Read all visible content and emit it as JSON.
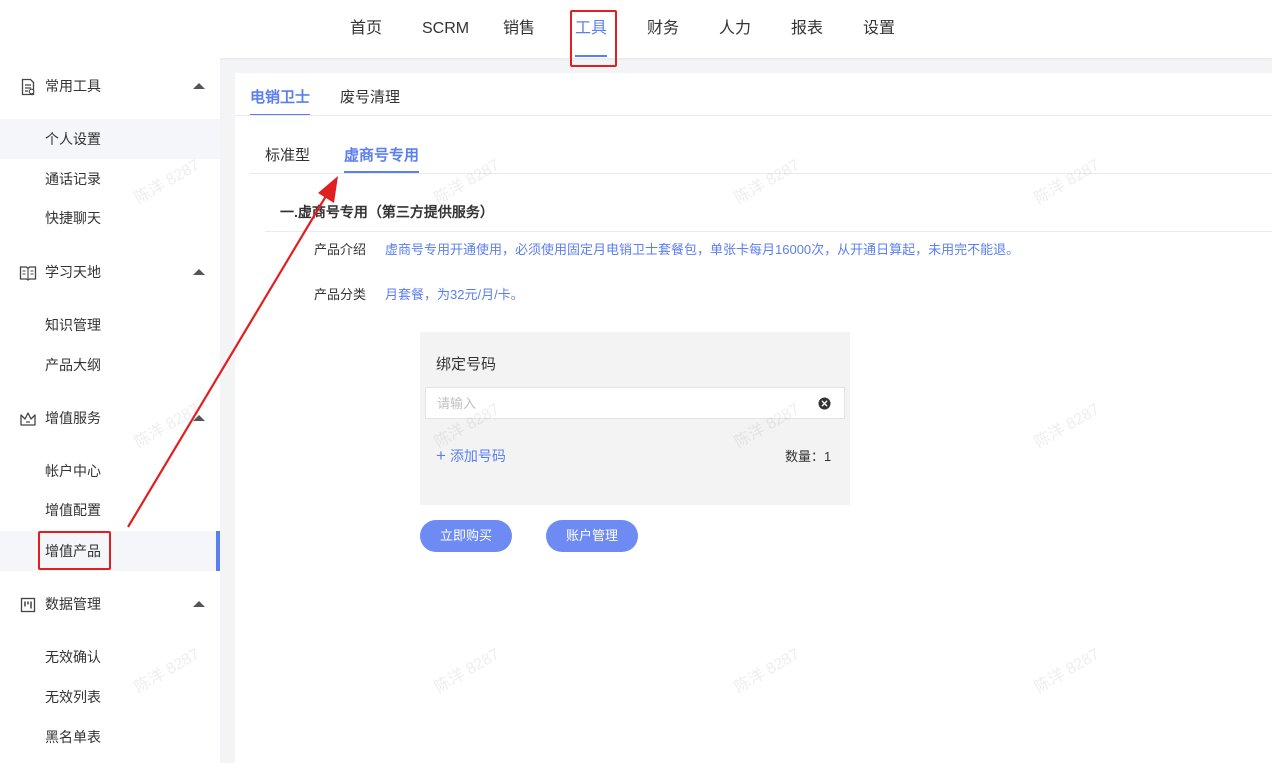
{
  "top_nav": {
    "items": [
      {
        "label": "首页"
      },
      {
        "label": "SCRM"
      },
      {
        "label": "销售"
      },
      {
        "label": "工具"
      },
      {
        "label": "财务"
      },
      {
        "label": "人力"
      },
      {
        "label": "报表"
      },
      {
        "label": "设置"
      }
    ],
    "active": "工具"
  },
  "sidebar": {
    "groups": [
      {
        "label": "常用工具",
        "icon": "document-icon",
        "items": [
          {
            "label": "个人设置"
          },
          {
            "label": "通话记录"
          },
          {
            "label": "快捷聊天"
          }
        ]
      },
      {
        "label": "学习天地",
        "icon": "book-icon",
        "items": [
          {
            "label": "知识管理"
          },
          {
            "label": "产品大纲"
          }
        ]
      },
      {
        "label": "增值服务",
        "icon": "crown-icon",
        "items": [
          {
            "label": "帐户中心"
          },
          {
            "label": "增值配置"
          },
          {
            "label": "增值产品"
          }
        ]
      },
      {
        "label": "数据管理",
        "icon": "kanban-icon",
        "items": [
          {
            "label": "无效确认"
          },
          {
            "label": "无效列表"
          },
          {
            "label": "黑名单表"
          }
        ]
      }
    ],
    "active_item": "增值产品"
  },
  "main": {
    "tabs": [
      {
        "label": "电销卫士"
      },
      {
        "label": "废号清理"
      }
    ],
    "subtabs": [
      {
        "label": "标准型"
      },
      {
        "label": "虚商号专用"
      }
    ],
    "section_title": "一.虚商号专用（第三方提供服务）",
    "product_intro_label": "产品介绍",
    "product_intro": "虚商号专用开通使用，必须使用固定月电销卫士套餐包，单张卡每月16000次，从开通日算起，未用完不能退。",
    "product_category_label": "产品分类",
    "product_category": "月套餐，为32元/月/卡。",
    "bind": {
      "title": "绑定号码",
      "placeholder": "请输入",
      "add_label": "添加号码",
      "count_label": "数量：1"
    },
    "buttons": {
      "buy": "立即购买",
      "account": "账户管理"
    }
  },
  "watermark": "陈洋 8287",
  "colors": {
    "accent": "#5b7ff0",
    "button": "#6d8bf3",
    "annotation": "#e02020"
  }
}
